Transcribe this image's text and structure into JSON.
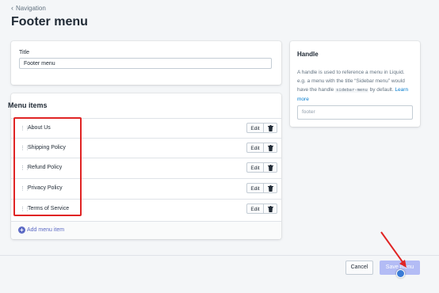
{
  "nav": {
    "back_label": "Navigation"
  },
  "page": {
    "title": "Footer menu"
  },
  "title_card": {
    "label": "Title",
    "value": "Footer menu"
  },
  "menu": {
    "heading": "Menu items",
    "items": [
      {
        "label": "About Us"
      },
      {
        "label": "Shipping Policy"
      },
      {
        "label": "Refund Policy"
      },
      {
        "label": "Privacy Policy"
      },
      {
        "label": "Terms of Service"
      }
    ],
    "edit_label": "Edit",
    "add_label": "Add menu item"
  },
  "handle": {
    "heading": "Handle",
    "desc_part1": "A handle is used to reference a menu in Liquid. e.g. a menu with the title “Sidebar menu” would have the handle ",
    "desc_code": "sidebar-menu",
    "desc_part2": " by default. ",
    "learn_more": "Learn more",
    "input_value": "footer"
  },
  "footer": {
    "cancel_label": "Cancel",
    "save_label": "Save menu"
  },
  "colors": {
    "accent": "#5c6ac4",
    "primary_disabled": "#b3bcf5",
    "highlight": "#e02424",
    "link": "#007ace"
  }
}
